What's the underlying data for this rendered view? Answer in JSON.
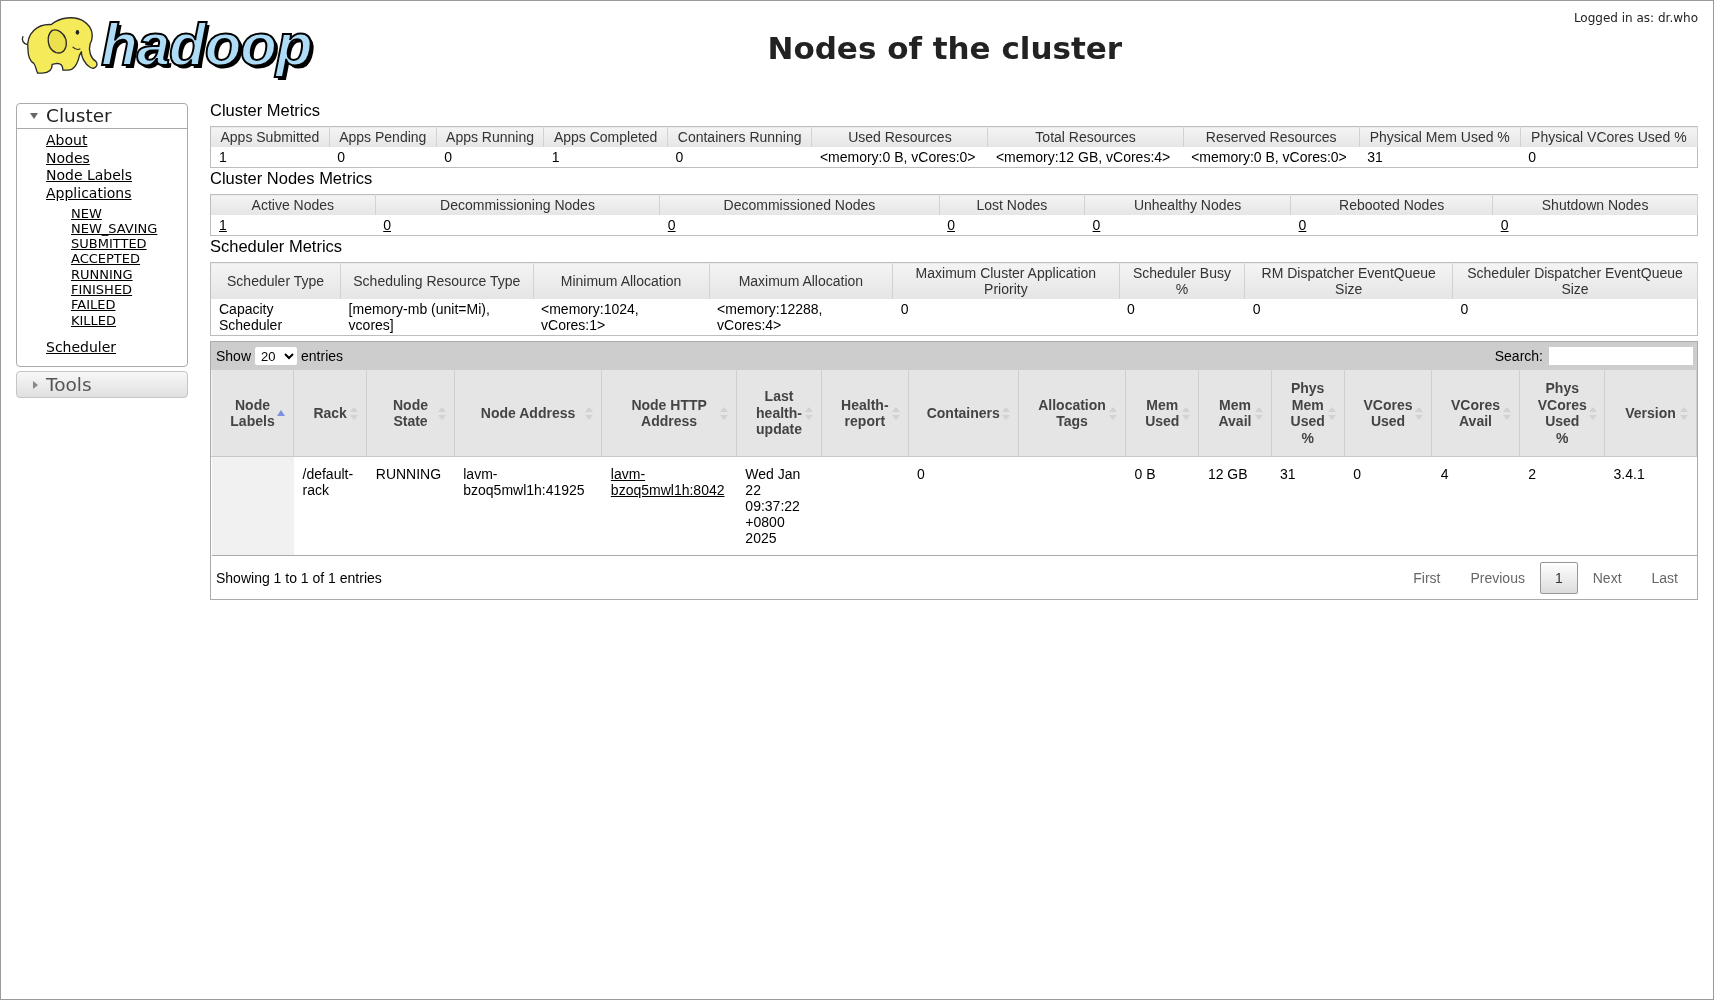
{
  "header": {
    "logo_text": "hadoop",
    "title": "Nodes of the cluster",
    "user_status": "Logged in as: dr.who"
  },
  "sidebar": [
    {
      "title": "Cluster",
      "expanded": true,
      "items": [
        {
          "label": "About"
        },
        {
          "label": "Nodes"
        },
        {
          "label": "Node Labels"
        },
        {
          "label": "Applications",
          "children": [
            {
              "label": "NEW"
            },
            {
              "label": "NEW_SAVING"
            },
            {
              "label": "SUBMITTED"
            },
            {
              "label": "ACCEPTED"
            },
            {
              "label": "RUNNING"
            },
            {
              "label": "FINISHED"
            },
            {
              "label": "FAILED"
            },
            {
              "label": "KILLED"
            }
          ]
        },
        {
          "label": "Scheduler"
        }
      ]
    },
    {
      "title": "Tools",
      "expanded": false
    }
  ],
  "metric_sections": [
    {
      "title": "Cluster Metrics",
      "columns": [
        "Apps Submitted",
        "Apps Pending",
        "Apps Running",
        "Apps Completed",
        "Containers Running",
        "Used Resources",
        "Total Resources",
        "Reserved Resources",
        "Physical Mem Used %",
        "Physical VCores Used %"
      ],
      "rows": [
        [
          "1",
          "0",
          "0",
          "1",
          "0",
          "<memory:0 B, vCores:0>",
          "<memory:12 GB, vCores:4>",
          "<memory:0 B, vCores:0>",
          "31",
          "0"
        ]
      ]
    },
    {
      "title": "Cluster Nodes Metrics",
      "columns": [
        "Active Nodes",
        "Decommissioning Nodes",
        "Decommissioned Nodes",
        "Lost Nodes",
        "Unhealthy Nodes",
        "Rebooted Nodes",
        "Shutdown Nodes"
      ],
      "rows": [
        [
          {
            "text": "1",
            "link": true
          },
          {
            "text": "0",
            "link": true
          },
          {
            "text": "0",
            "link": true
          },
          {
            "text": "0",
            "link": true
          },
          {
            "text": "0",
            "link": true
          },
          {
            "text": "0",
            "link": true
          },
          {
            "text": "0",
            "link": true
          }
        ]
      ]
    },
    {
      "title": "Scheduler Metrics",
      "columns": [
        "Scheduler Type",
        "Scheduling Resource Type",
        "Minimum Allocation",
        "Maximum Allocation",
        "Maximum Cluster Application Priority",
        "Scheduler Busy %",
        "RM Dispatcher EventQueue Size",
        "Scheduler Dispatcher EventQueue Size"
      ],
      "rows": [
        [
          "Capacity Scheduler",
          "[memory-mb (unit=Mi), vcores]",
          "<memory:1024, vCores:1>",
          "<memory:12288, vCores:4>",
          "0",
          "0",
          "0",
          "0"
        ]
      ]
    }
  ],
  "nodes_table": {
    "length_menu": {
      "before": "Show",
      "value": "20",
      "after": "entries"
    },
    "search": {
      "label": "Search:"
    },
    "columns": [
      {
        "label": "Node Labels",
        "sorted": true
      },
      {
        "label": "Rack",
        "sorted": false
      },
      {
        "label": "Node State",
        "sorted": false
      },
      {
        "label": "Node Address",
        "sorted": false
      },
      {
        "label": "Node HTTP Address",
        "sorted": false
      },
      {
        "label": "Last health-update",
        "sorted": false
      },
      {
        "label": "Health-report",
        "sorted": false
      },
      {
        "label": "Containers",
        "sorted": false
      },
      {
        "label": "Allocation Tags",
        "sorted": false
      },
      {
        "label": "Mem Used",
        "sorted": false
      },
      {
        "label": "Mem Avail",
        "sorted": false
      },
      {
        "label": "Phys Mem Used %",
        "sorted": false
      },
      {
        "label": "VCores Used",
        "sorted": false
      },
      {
        "label": "VCores Avail",
        "sorted": false
      },
      {
        "label": "Phys VCores Used %",
        "sorted": false
      },
      {
        "label": "Version",
        "sorted": false
      }
    ],
    "rows": [
      [
        null,
        "/default-rack",
        "RUNNING",
        "lavm-bzoq5mwl1h:41925",
        {
          "text": "lavm-bzoq5mwl1h:8042",
          "link": true
        },
        "Wed Jan 22 09:37:22 +0800 2025",
        null,
        "0",
        null,
        "0 B",
        "12 GB",
        "31",
        "0",
        "4",
        "2",
        "3.4.1"
      ]
    ],
    "info": "Showing 1 to 1 of 1 entries",
    "pagination": [
      {
        "label": "First",
        "selected": false,
        "disabled": true
      },
      {
        "label": "Previous",
        "selected": false,
        "disabled": true
      },
      {
        "label": "1",
        "selected": true,
        "disabled": false
      },
      {
        "label": "Next",
        "selected": false,
        "disabled": true
      },
      {
        "label": "Last",
        "selected": false,
        "disabled": true
      }
    ]
  }
}
